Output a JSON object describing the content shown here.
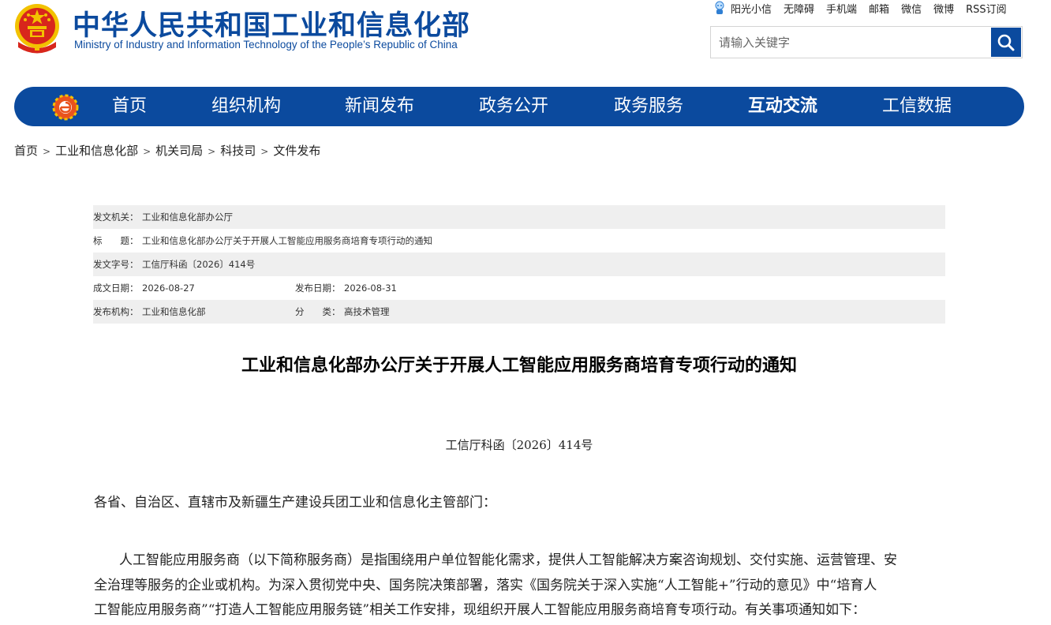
{
  "header": {
    "title": "中华人民共和国工业和信息化部",
    "subtitle": "Ministry of Industry and Information Technology of the People’s Republic of China",
    "emblem_icon": "national-emblem-icon"
  },
  "top_links": [
    "阳光小信",
    "无障碍",
    "手机端",
    "邮箱",
    "微信",
    "微博",
    "RSS订阅"
  ],
  "search": {
    "placeholder": "请输入关键字",
    "value": "",
    "icon": "search-icon"
  },
  "nav": {
    "logo_icon": "miit-logo-icon",
    "items": [
      "首页",
      "组织机构",
      "新闻发布",
      "政务公开",
      "政务服务",
      "互动交流",
      "工信数据"
    ]
  },
  "breadcrumb": [
    "首页",
    "工业和信息化部",
    "机关司局",
    "科技司",
    "文件发布"
  ],
  "meta": {
    "issuer_label": "发文机关：",
    "issuer": "工业和信息化部办公厅",
    "title_label": "标　　题：",
    "title": "工业和信息化部办公厅关于开展人工智能应用服务商培育专项行动的通知",
    "docno_label": "发文字号：",
    "docno": "工信厅科函〔2026〕414号",
    "created_label": "成文日期：",
    "created": "2026-08-27",
    "published_label": "发布日期：",
    "published": "2026-08-31",
    "org_label": "发布机构：",
    "org": "工业和信息化部",
    "category_label": "分　　类：",
    "category": "高技术管理"
  },
  "article": {
    "title": "工业和信息化部办公厅关于开展人工智能应用服务商培育专项行动的通知",
    "doc_number": "工信厅科函〔2026〕414号",
    "addressee": "各省、自治区、直辖市及新疆生产建设兵团工业和信息化主管部门：",
    "paragraph_lines": [
      "人工智能应用服务商（以下简称服务商）是指围绕用户单位智能化需求，提供人工智能解决方案咨询规划、交付实施、运营管理、安",
      "全治理等服务的企业或机构。为深入贯彻党中央、国务院决策部署，落实《国务院关于深入实施“人工智能+”行动的意见》中“培育人",
      "工智能应用服务商”“打造人工智能应用服务链”相关工作安排，现组织开展人工智能应用服务商培育专项行动。有关事项通知如下："
    ]
  },
  "colors": {
    "brand_blue": "#0b4a9e",
    "meta_shade": "#efefef",
    "emblem_red": "#d8261c",
    "emblem_gold": "#f2c200"
  }
}
